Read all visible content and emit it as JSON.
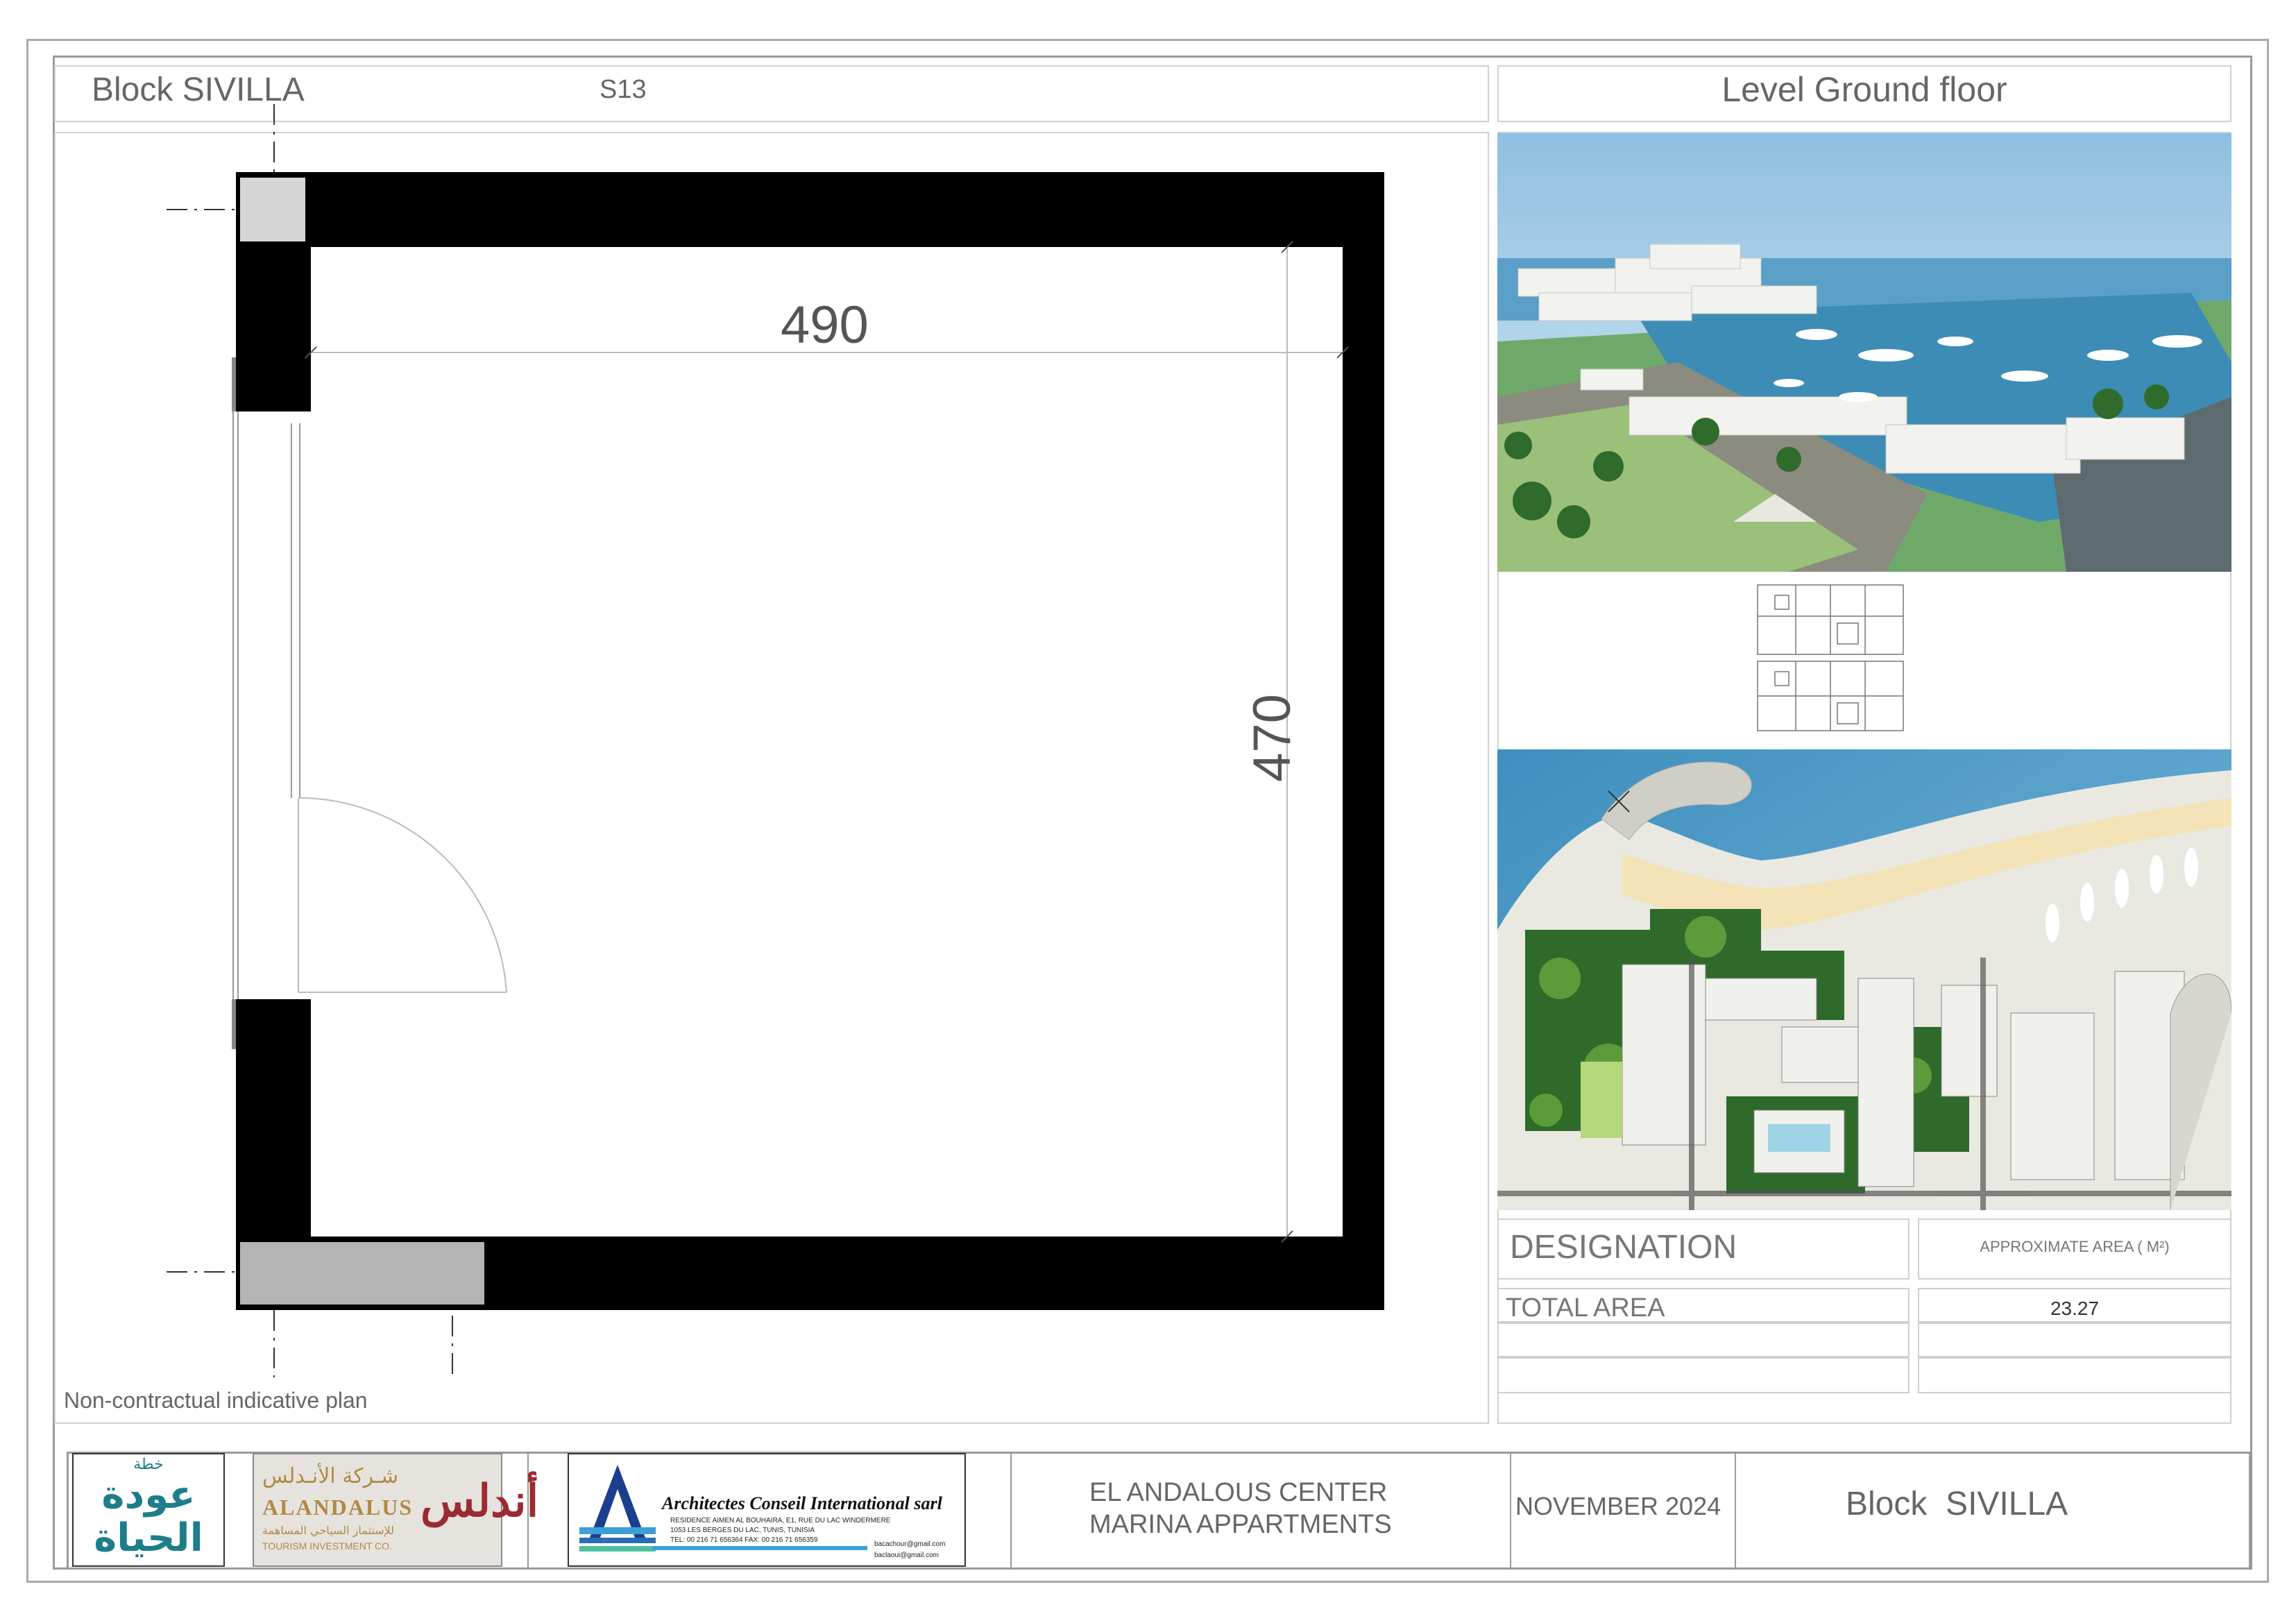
{
  "header": {
    "block_label": "Block SIVILLA",
    "unit_code": "S13",
    "level_label": "Level Ground floor"
  },
  "plan": {
    "width_dimension": "490",
    "height_dimension": "470",
    "disclaimer": "Non-contractual indicative plan"
  },
  "area_table": {
    "designation_header": "DESIGNATION",
    "area_header": "APPROXIMATE AREA ( M²)",
    "rows": [
      {
        "label": "TOTAL AREA",
        "value": "23.27"
      },
      {
        "label": "",
        "value": ""
      },
      {
        "label": "",
        "value": ""
      }
    ]
  },
  "footer": {
    "logo1_text_top": "خطة",
    "logo1_text": "عودة الحياة",
    "logo2_arabic": "شـركة الأنـدلس",
    "logo2_name": "ALANDALUS",
    "logo2_arabic_sub": "للإستثمار السياحي المساهمة",
    "logo2_sub": "TOURISM INVESTMENT CO.",
    "logo2_mark": "أندلس",
    "architect_name": "Architectes Conseil International sarl",
    "architect_address1": "RESIDENCE AIMEN AL BOUHAIRA, E1, RUE DU LAC WINDERMERE",
    "architect_address2": "1053 LES BERGES DU LAC, TUNIS, TUNISIA",
    "architect_phone": "TEL: 00 216 71 656364   FAX: 00 216 71 656359",
    "architect_email1": "bacachour@gmail.com",
    "architect_email2": "baclaoui@gmail.com",
    "project_line1": "EL ANDALOUS CENTER",
    "project_line2": "MARINA APPARTMENTS",
    "date": "NOVEMBER 2024",
    "block": "Block  SIVILLA"
  },
  "colors": {
    "wall": "#000000",
    "column": "#d6d6d6",
    "window_grey": "#b4b4b4",
    "frame": "#9a9a9a",
    "sea": "#4f9ec4",
    "sky": "#bcd9ea",
    "green": "#4a8a3a",
    "logo_teal": "#1d7e8a",
    "logo_red": "#9b2a33"
  }
}
